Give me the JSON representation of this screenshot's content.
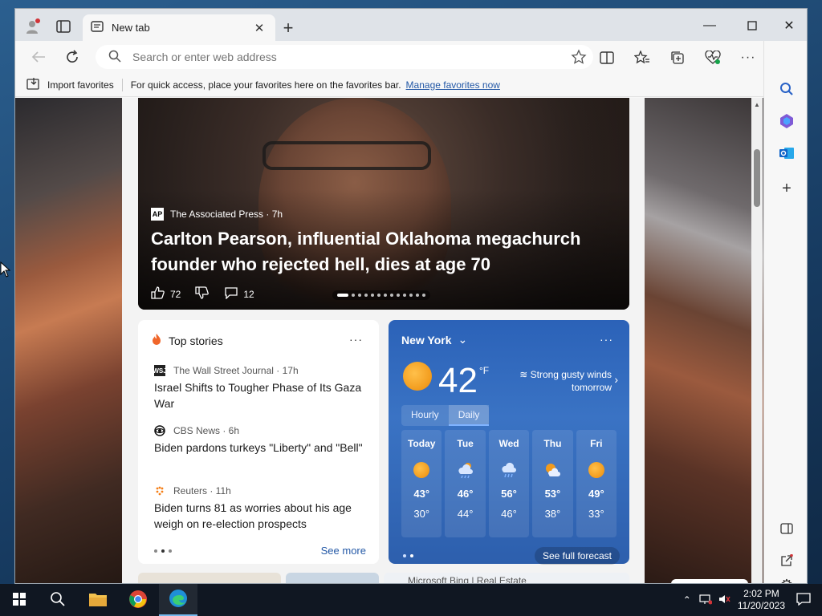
{
  "browser": {
    "tab_title": "New tab",
    "address_placeholder": "Search or enter web address",
    "favorites_bar": {
      "import_label": "Import favorites",
      "hint_text": "For quick access, place your favorites here on the favorites bar.",
      "manage_link": "Manage favorites now"
    }
  },
  "hero": {
    "source": "The Associated Press · 7h",
    "source_logo": "AP",
    "title": "Carlton Pearson, influential Oklahoma megachurch founder who rejected hell, dies at age 70",
    "likes": "72",
    "comments": "12"
  },
  "top_stories": {
    "title": "Top stories",
    "more": "···",
    "items": [
      {
        "source": "The Wall Street Journal · 17h",
        "logo": "WSJ",
        "headline": "Israel Shifts to Tougher Phase of Its Gaza War"
      },
      {
        "source": "CBS News · 6h",
        "logo": "CBS",
        "headline": "Biden pardons turkeys \"Liberty\" and \"Bell\""
      },
      {
        "source": "Reuters · 11h",
        "logo": "R",
        "headline": "Biden turns 81 as worries about his age weigh on re-election prospects"
      }
    ],
    "see_more": "See more"
  },
  "weather": {
    "location": "New York",
    "more": "···",
    "temperature": "42",
    "unit": "°F",
    "condition": "Strong gusty winds tomorrow",
    "tabs": [
      "Hourly",
      "Daily"
    ],
    "selected_tab": "Daily",
    "days": [
      {
        "name": "Today",
        "icon": "sunny-icon",
        "high": "43°",
        "low": "30°"
      },
      {
        "name": "Tue",
        "icon": "rain-icon",
        "high": "46°",
        "low": "44°"
      },
      {
        "name": "Wed",
        "icon": "rain-icon",
        "high": "56°",
        "low": "46°"
      },
      {
        "name": "Thu",
        "icon": "partly-cloudy-icon",
        "high": "53°",
        "low": "38°"
      },
      {
        "name": "Fri",
        "icon": "sunny-icon",
        "high": "49°",
        "low": "33°"
      }
    ],
    "forecast_link": "See full forecast"
  },
  "bottom_peek": {
    "card2_text": "Microsoft Bing | Real Estate"
  },
  "taskbar": {
    "time": "2:02 PM",
    "date": "11/20/2023"
  },
  "colors": {
    "accent": "#2358a6",
    "weather_bg": "#2b62b8",
    "taskbar": "#101722"
  }
}
